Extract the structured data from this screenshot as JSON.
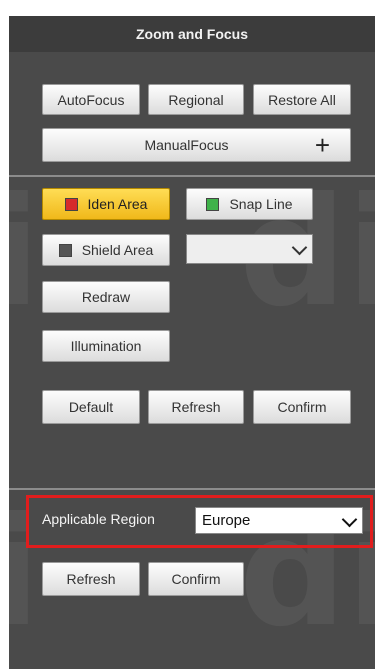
{
  "panel": {
    "title": "Zoom and Focus"
  },
  "focus": {
    "autofocus_label": "AutoFocus",
    "regional_label": "Regional",
    "restore_label": "Restore All",
    "manual_label": "ManualFocus",
    "manual_icon": "plus-icon"
  },
  "areas": {
    "iden_label": "Iden Area",
    "iden_color": "#d62b2b",
    "snap_label": "Snap Line",
    "snap_color": "#3fb24a",
    "shield_label": "Shield Area",
    "shield_color": "#555555",
    "shield_select_value": ""
  },
  "actions": {
    "redraw_label": "Redraw",
    "illumination_label": "Illumination",
    "default_label": "Default",
    "refresh_label": "Refresh",
    "confirm_label": "Confirm"
  },
  "region": {
    "label": "Applicable Region",
    "value": "Europe",
    "refresh_label": "Refresh",
    "confirm_label": "Confirm",
    "highlight_color": "#e11d1d"
  },
  "colors": {
    "panel_bg": "#4a4a4a",
    "header_bg": "#3c3c3c",
    "active_button": "#f0b81a"
  }
}
